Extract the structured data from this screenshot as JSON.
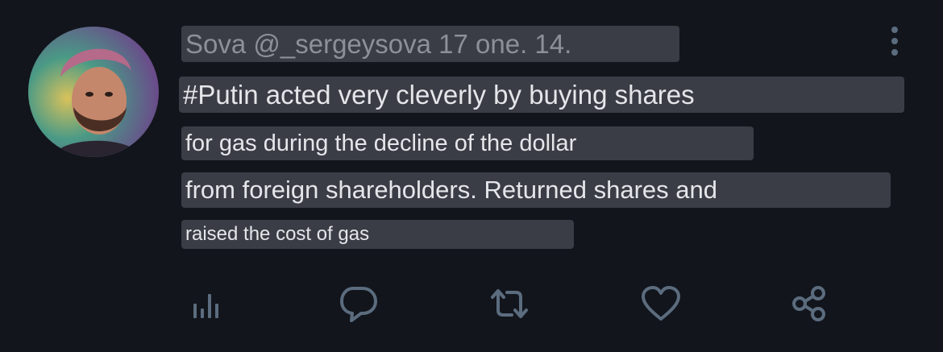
{
  "tweet": {
    "author_line": "Sova @_sergeysova 17 one. 14.",
    "text_lines": [
      "#Putin acted very cleverly by buying shares",
      "for gas during the decline of the dollar",
      "from foreign shareholders. Returned shares and",
      "raised the cost of gas"
    ]
  },
  "icons": {
    "more": "more-vertical-icon",
    "views": "bar-chart-icon",
    "reply": "reply-bubble-icon",
    "retweet": "retweet-icon",
    "like": "heart-icon",
    "share": "share-icon"
  },
  "colors": {
    "background": "#12151c",
    "highlight": "#3a3d45",
    "icon": "#5b6c7e",
    "text": "#e4e6ea",
    "muted_text": "#8d9097"
  }
}
